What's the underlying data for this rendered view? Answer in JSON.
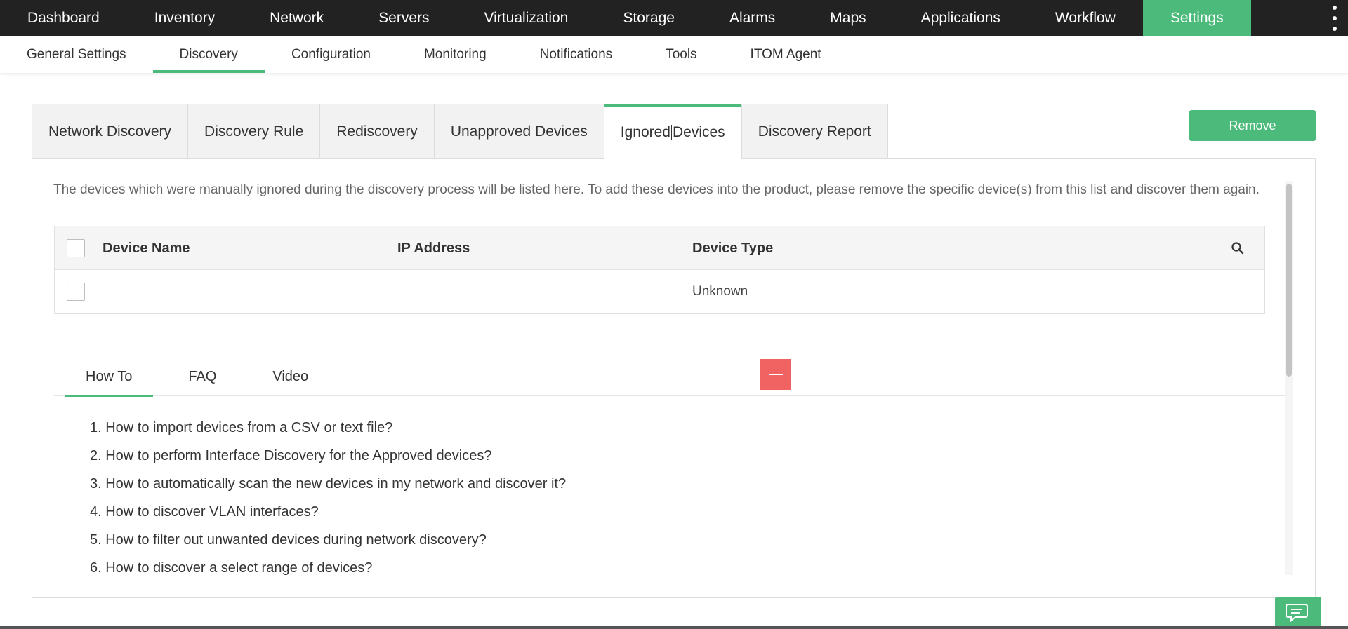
{
  "topnav": {
    "items": [
      "Dashboard",
      "Inventory",
      "Network",
      "Servers",
      "Virtualization",
      "Storage",
      "Alarms",
      "Maps",
      "Applications",
      "Workflow",
      "Settings"
    ],
    "active": "Settings"
  },
  "subnav": {
    "items": [
      "General Settings",
      "Discovery",
      "Configuration",
      "Monitoring",
      "Notifications",
      "Tools",
      "ITOM Agent"
    ],
    "active": "Discovery"
  },
  "tabs": {
    "items": [
      "Network Discovery",
      "Discovery Rule",
      "Rediscovery",
      "Unapproved Devices",
      "Ignored",
      "Devices",
      "Discovery Report"
    ],
    "active": "Ignored Devices"
  },
  "actions": {
    "remove_label": "Remove"
  },
  "description": "The devices which were manually ignored during the discovery process will be listed here. To add these devices into the product, please remove the specific device(s) from this list and discover them again.",
  "table": {
    "columns": [
      "Device Name",
      "IP Address",
      "Device Type"
    ],
    "rows": [
      {
        "device_name": "",
        "ip_address": "",
        "device_type": "Unknown"
      }
    ]
  },
  "help": {
    "tabs": [
      "How To",
      "FAQ",
      "Video"
    ],
    "active": "How To",
    "items": [
      "1. How to import devices from a CSV or text file?",
      "2. How to perform Interface Discovery for the Approved devices?",
      "3. How to automatically scan the new devices in my network and discover it?",
      "4. How to discover VLAN interfaces?",
      "5. How to filter out unwanted devices during network discovery?",
      "6. How to discover a select range of devices?"
    ]
  },
  "colors": {
    "accent": "#4cba7a",
    "nav_bg": "#222222",
    "collapse": "#f16363"
  },
  "icons": {
    "search": "search-icon",
    "chat": "chat-icon",
    "more": "more-vertical-icon",
    "collapse": "minus-icon"
  }
}
